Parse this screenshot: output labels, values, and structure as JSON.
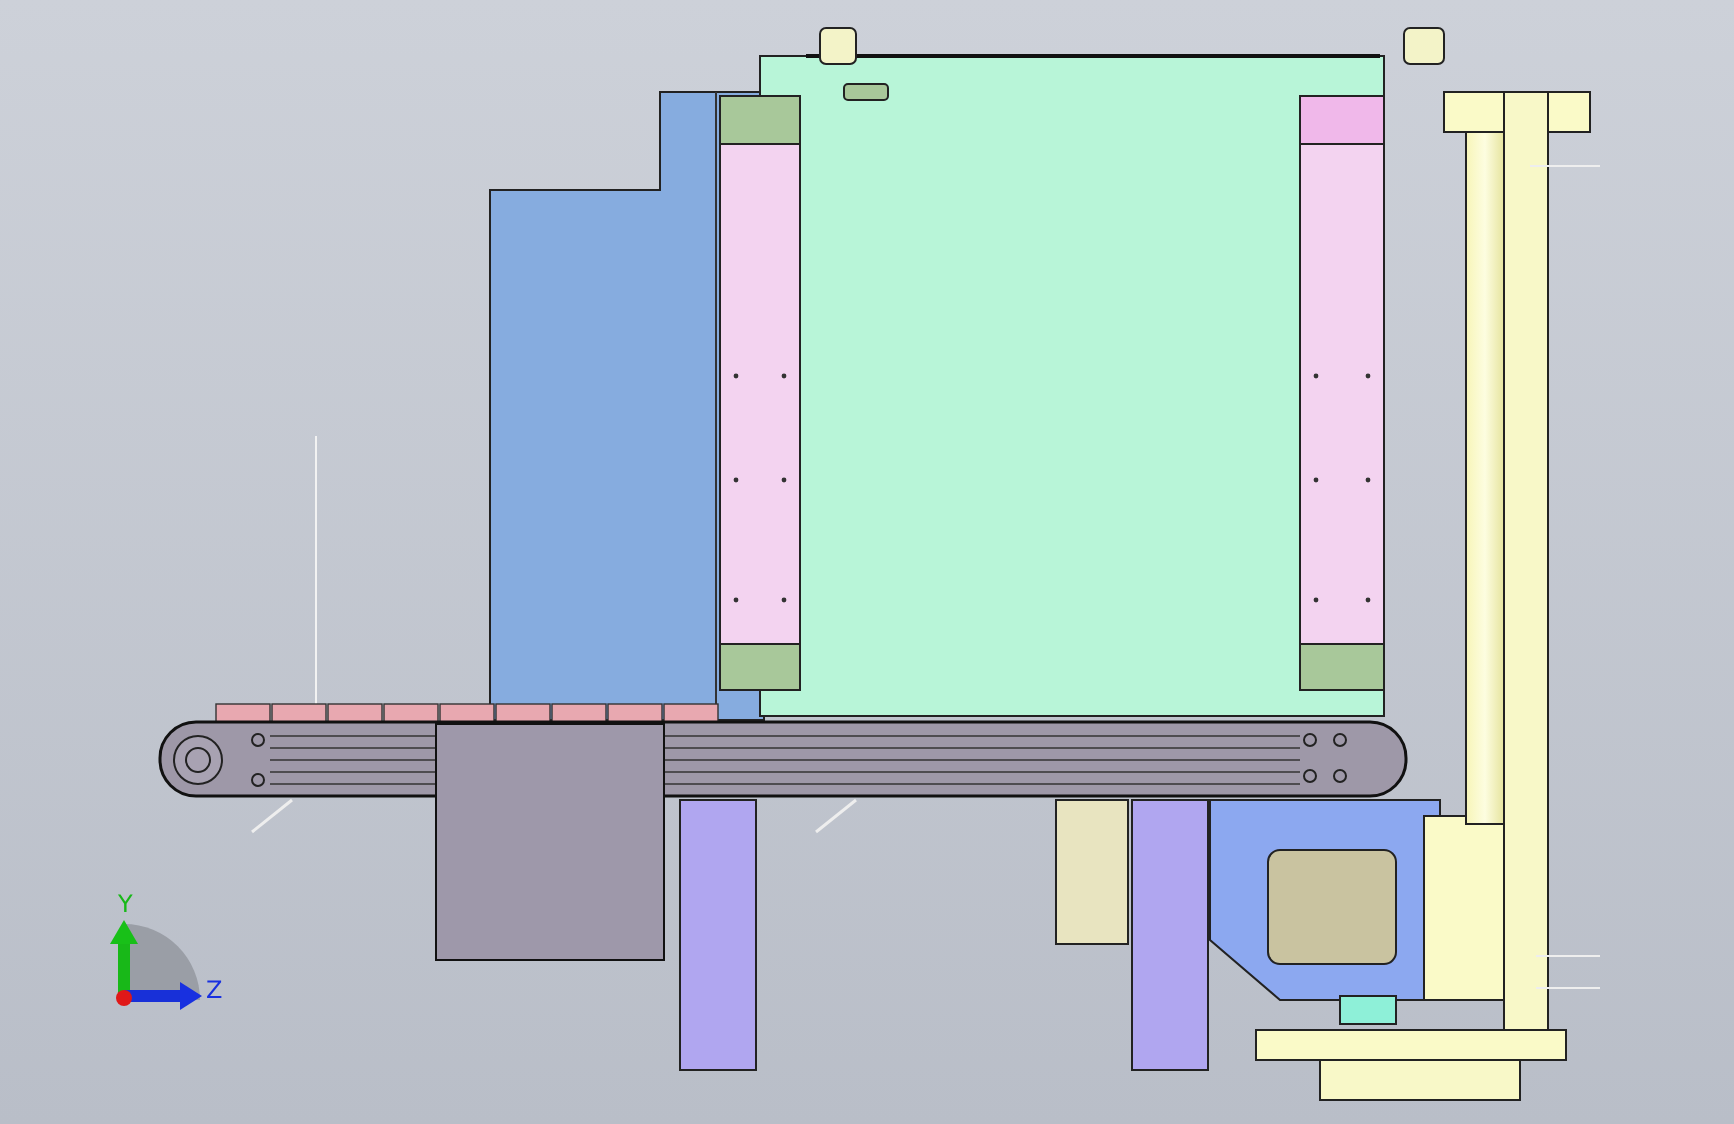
{
  "axis_triad": {
    "labels": [
      "Y",
      "Z"
    ]
  }
}
